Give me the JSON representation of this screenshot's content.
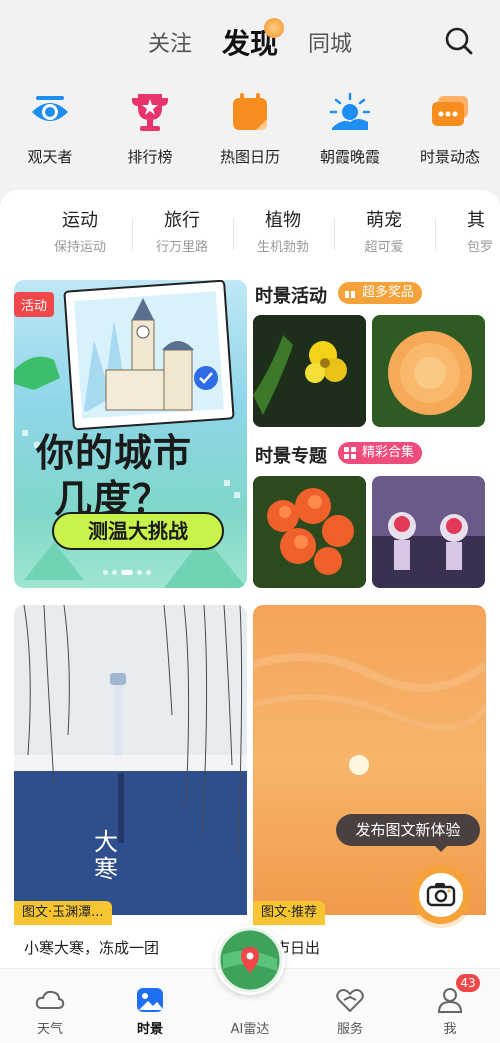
{
  "top_tabs": [
    "关注",
    "发现",
    "同城"
  ],
  "entries": [
    "观天者",
    "排行榜",
    "热图日历",
    "朝霞晚霞",
    "时景动态"
  ],
  "categories": [
    {
      "name": "运动",
      "desc": "保持运动"
    },
    {
      "name": "旅行",
      "desc": "行万里路"
    },
    {
      "name": "植物",
      "desc": "生机勃勃"
    },
    {
      "name": "萌宠",
      "desc": "超可爱"
    },
    {
      "name": "其",
      "desc": "包罗"
    }
  ],
  "banner": {
    "tag": "活动",
    "title_line1": "你的城市",
    "title_line2": "几度？",
    "subtitle": "测温大挑战"
  },
  "sections": {
    "activity": {
      "title": "时景活动",
      "badge": "超多奖品",
      "badge_color": "#f5a23a"
    },
    "topic": {
      "title": "时景专题",
      "badge": "精彩合集",
      "badge_color": "#ee4d7c"
    }
  },
  "cards": [
    {
      "tag": "图文·玉渊潭...",
      "caption": "小寒大寒，冻成一团"
    },
    {
      "tag": "图文·推荐",
      "caption": "市日出"
    }
  ],
  "publish_bubble": "发布图文新体验",
  "bottom_nav": [
    "天气",
    "时景",
    "AI雷达",
    "服务",
    "我"
  ],
  "notification_count": "43"
}
